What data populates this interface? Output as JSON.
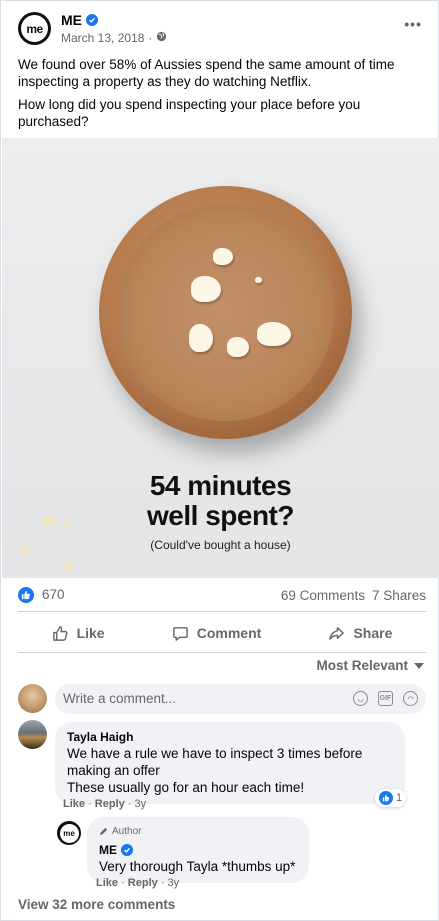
{
  "post": {
    "author": "ME",
    "date": "March 13, 2018",
    "separator": "·",
    "logo_text": "me",
    "text_1": "We found over 58% of Aussies spend the same amount of time inspecting a property as they do watching Netflix.",
    "text_2": "How long did you spend inspecting your place before you purchased?"
  },
  "image": {
    "headline_1": "54 minutes",
    "headline_2": "well spent?",
    "subtext": "(Could've bought a house)"
  },
  "stats": {
    "likes": "670",
    "comments": "69 Comments",
    "shares": "7 Shares"
  },
  "actions": {
    "like": "Like",
    "comment": "Comment",
    "share": "Share"
  },
  "sort_label": "Most Relevant",
  "comment_input": {
    "placeholder": "Write a comment..."
  },
  "comments": [
    {
      "name": "Tayla Haigh",
      "text_1": "We have a rule we have to inspect 3 times before making an offer",
      "text_2": "These usually go for an hour each time!",
      "like": "Like",
      "reply": "Reply",
      "age": "3y",
      "reactions": "1"
    },
    {
      "author_tag": "Author",
      "name": "ME",
      "text": "Very thorough Tayla *thumbs up*",
      "like": "Like",
      "reply": "Reply",
      "age": "3y"
    }
  ],
  "view_more": "View 32 more comments",
  "colors": {
    "accent": "#1877f2",
    "muted": "#65676b",
    "bubble": "#f0f2f5"
  }
}
